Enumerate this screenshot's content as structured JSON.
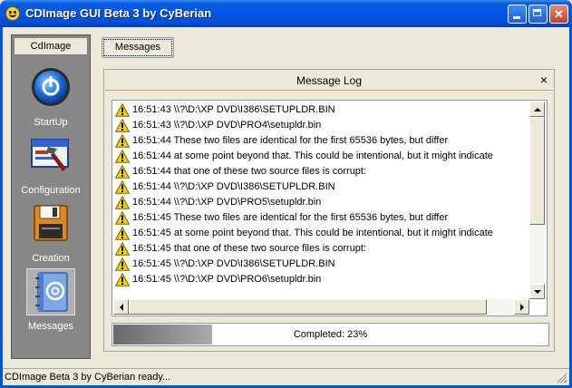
{
  "window": {
    "title": "CDImage GUI Beta 3 by CyBerian"
  },
  "nav": {
    "header": "CdImage",
    "items": [
      {
        "label": "StartUp",
        "icon": "power-icon"
      },
      {
        "label": "Configuration",
        "icon": "config-window-icon"
      },
      {
        "label": "Creation",
        "icon": "floppy-disk-icon"
      },
      {
        "label": "Messages",
        "icon": "address-book-icon",
        "selected": true
      }
    ]
  },
  "tab": {
    "label": "Messages"
  },
  "log": {
    "title": "Message Log",
    "close_glyph": "×",
    "rows": [
      "16:51:43 \\\\?\\D:\\XP DVD\\I386\\SETUPLDR.BIN",
      "16:51:43 \\\\?\\D:\\XP DVD\\PRO4\\setupldr.bin",
      "16:51:44 These two files are identical for the first 65536 bytes, but differ",
      "16:51:44 at some point beyond that.  This could be intentional, but it might indicate",
      "16:51:44 that one of these two source files is corrupt:",
      "16:51:44 \\\\?\\D:\\XP DVD\\I386\\SETUPLDR.BIN",
      "16:51:44 \\\\?\\D:\\XP DVD\\PRO5\\setupldr.bin",
      "16:51:45 These two files are identical for the first 65536 bytes, but differ",
      "16:51:45 at some point beyond that.  This could be intentional, but it might indicate",
      "16:51:45 that one of these two source files is corrupt:",
      "16:51:45 \\\\?\\D:\\XP DVD\\I386\\SETUPLDR.BIN",
      "16:51:45 \\\\?\\D:\\XP DVD\\PRO6\\setupldr.bin"
    ],
    "row_icon": "warning-icon"
  },
  "progress": {
    "text": "Completed: 23%",
    "fraction": 0.23
  },
  "status": {
    "text": "CDImage Beta 3 by CyBerian ready..."
  },
  "colors": {
    "titlebar": "#0054e3",
    "nav_bg": "#878787",
    "warning": "#f5d000"
  }
}
